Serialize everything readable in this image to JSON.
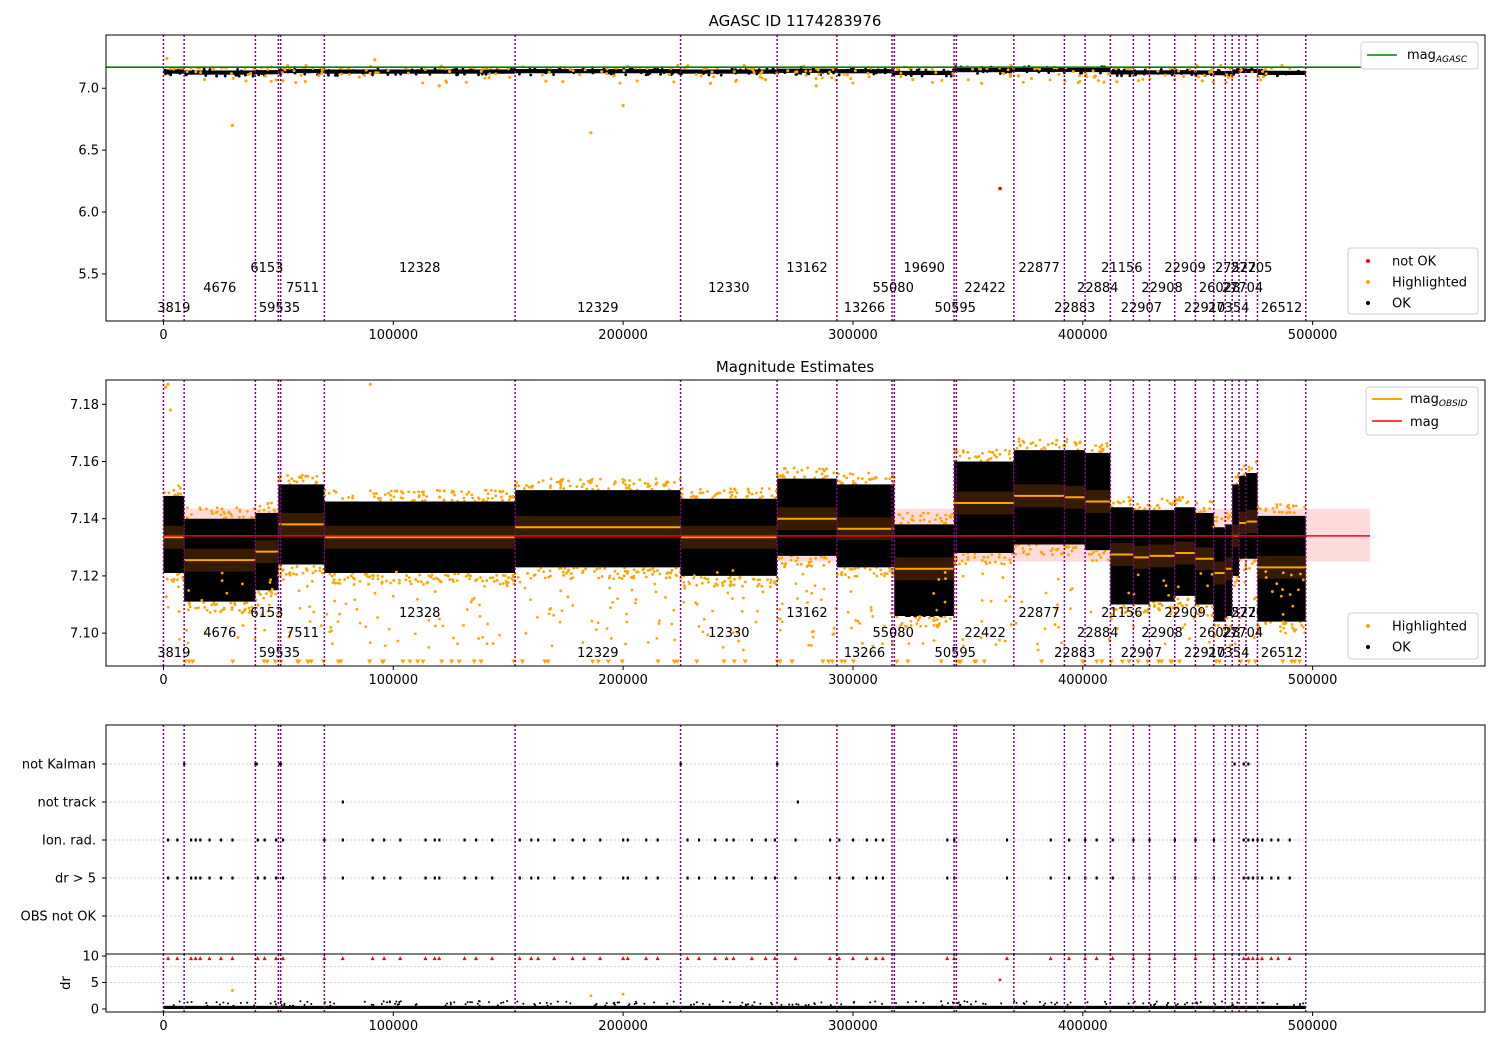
{
  "chart_data": [
    {
      "type": "scatter",
      "title": "AGASC ID 1174283976",
      "xlim": [
        -25000,
        575000
      ],
      "ylim": [
        5.12,
        7.43
      ],
      "xticks": [
        0,
        100000,
        200000,
        300000,
        400000,
        500000
      ],
      "xtick_labels": [
        "0",
        "100000",
        "200000",
        "300000",
        "400000",
        "500000"
      ],
      "yticks": [
        5.5,
        6.0,
        6.5,
        7.0
      ],
      "ytick_labels": [
        "5.5",
        "6.0",
        "6.5",
        "7.0"
      ],
      "reference_line": {
        "name": "mag$_{AGASC}$",
        "label_main": "mag",
        "label_sub": "AGASC",
        "y": 7.17,
        "color": "#008000"
      },
      "series": [
        {
          "name": "not OK",
          "color": "#ff0000",
          "points": [
            [
              364000,
              6.19
            ]
          ]
        },
        {
          "name": "Highlighted",
          "color": "#ffa500",
          "points": [
            [
              1500,
              7.24
            ],
            [
              30000,
              6.7
            ],
            [
              92000,
              7.23
            ],
            [
              52000,
              7.06
            ],
            [
              120000,
              7.02
            ],
            [
              186000,
              6.64
            ],
            [
              196000,
              7.1
            ],
            [
              200000,
              6.86
            ],
            [
              238000,
              7.04
            ],
            [
              262000,
              7.07
            ],
            [
              284000,
              7.02
            ],
            [
              326000,
              7.07
            ],
            [
              356000,
              7.04
            ],
            [
              372000,
              7.1
            ],
            [
              405000,
              7.09
            ],
            [
              440000,
              7.07
            ],
            [
              452000,
              7.06
            ]
          ]
        },
        {
          "name": "OK",
          "color": "#000000",
          "points": []
        }
      ],
      "legend_items": [
        "not OK",
        "Highlighted",
        "OK"
      ],
      "legend_ref": "top-right",
      "legend_points": "lower-right"
    },
    {
      "type": "scatter",
      "title": "Magnitude Estimates",
      "xlim": [
        -25000,
        575000
      ],
      "ylim": [
        7.0885,
        7.1885
      ],
      "xticks": [
        0,
        100000,
        200000,
        300000,
        400000,
        500000
      ],
      "xtick_labels": [
        "0",
        "100000",
        "200000",
        "300000",
        "400000",
        "500000"
      ],
      "yticks": [
        7.1,
        7.12,
        7.14,
        7.16,
        7.18
      ],
      "ytick_labels": [
        "7.10",
        "7.12",
        "7.14",
        "7.16",
        "7.18"
      ],
      "mag_line": {
        "name": "mag",
        "y": 7.134,
        "band": [
          7.125,
          7.1435
        ],
        "color": "#ff0000"
      },
      "obsid_series_name": "mag$_{OBSID}$",
      "obsid_label_main": "mag",
      "obsid_label_sub": "OBSID",
      "legend_items": [
        "Highlighted",
        "OK"
      ]
    },
    {
      "type": "scatter",
      "title": "",
      "xlim": [
        -25000,
        575000
      ],
      "flag_rows": [
        "not Kalman",
        "not track",
        "Ion. rad.",
        "dr > 5",
        "OBS not OK"
      ],
      "dr_yticks": [
        0,
        5,
        10
      ],
      "dr_ytick_labels": [
        "0",
        "5",
        "10"
      ],
      "dr_ylabel": "dr"
    }
  ],
  "observations": [
    {
      "obsid": "3819",
      "start": 0,
      "end": 9000,
      "mag": 7.1335,
      "y_lo": 7.121,
      "y_hi": 7.148
    },
    {
      "obsid": "4676",
      "start": 9000,
      "end": 40000,
      "mag": 7.1255,
      "y_lo": 7.111,
      "y_hi": 7.14
    },
    {
      "obsid": "6153",
      "start": 40000,
      "end": 50000,
      "mag": 7.1285,
      "y_lo": 7.115,
      "y_hi": 7.142
    },
    {
      "obsid": "59535",
      "start": 50000,
      "end": 51000,
      "mag": 7.138,
      "y_lo": 7.124,
      "y_hi": 7.152
    },
    {
      "obsid": "7511",
      "start": 51000,
      "end": 70000,
      "mag": 7.138,
      "y_lo": 7.124,
      "y_hi": 7.152
    },
    {
      "obsid": "12328",
      "start": 70000,
      "end": 153000,
      "mag": 7.1335,
      "y_lo": 7.121,
      "y_hi": 7.146
    },
    {
      "obsid": "12329",
      "start": 153000,
      "end": 225000,
      "mag": 7.137,
      "y_lo": 7.123,
      "y_hi": 7.15
    },
    {
      "obsid": "12330",
      "start": 225000,
      "end": 267000,
      "mag": 7.1335,
      "y_lo": 7.12,
      "y_hi": 7.147
    },
    {
      "obsid": "13162",
      "start": 267000,
      "end": 293000,
      "mag": 7.14,
      "y_lo": 7.127,
      "y_hi": 7.154
    },
    {
      "obsid": "13266",
      "start": 293000,
      "end": 317000,
      "mag": 7.1365,
      "y_lo": 7.123,
      "y_hi": 7.152
    },
    {
      "obsid": "55080",
      "start": 317000,
      "end": 318000,
      "mag": 7.1365,
      "y_lo": 7.123,
      "y_hi": 7.152
    },
    {
      "obsid": "19690",
      "start": 318000,
      "end": 344000,
      "mag": 7.1225,
      "y_lo": 7.106,
      "y_hi": 7.138
    },
    {
      "obsid": "50595",
      "start": 344000,
      "end": 345000,
      "mag": 7.1455,
      "y_lo": 7.128,
      "y_hi": 7.16
    },
    {
      "obsid": "22422",
      "start": 345000,
      "end": 370000,
      "mag": 7.1455,
      "y_lo": 7.128,
      "y_hi": 7.16
    },
    {
      "obsid": "22877",
      "start": 370000,
      "end": 392000,
      "mag": 7.148,
      "y_lo": 7.131,
      "y_hi": 7.164
    },
    {
      "obsid": "22883",
      "start": 392000,
      "end": 401000,
      "mag": 7.1475,
      "y_lo": 7.131,
      "y_hi": 7.164
    },
    {
      "obsid": "22884",
      "start": 401000,
      "end": 412000,
      "mag": 7.146,
      "y_lo": 7.129,
      "y_hi": 7.163
    },
    {
      "obsid": "21156",
      "start": 412000,
      "end": 422000,
      "mag": 7.1275,
      "y_lo": 7.11,
      "y_hi": 7.144
    },
    {
      "obsid": "22907",
      "start": 422000,
      "end": 429000,
      "mag": 7.1265,
      "y_lo": 7.11,
      "y_hi": 7.143
    },
    {
      "obsid": "22908",
      "start": 429000,
      "end": 440000,
      "mag": 7.127,
      "y_lo": 7.111,
      "y_hi": 7.143
    },
    {
      "obsid": "22909",
      "start": 440000,
      "end": 449000,
      "mag": 7.128,
      "y_lo": 7.113,
      "y_hi": 7.144
    },
    {
      "obsid": "22910",
      "start": 449000,
      "end": 457000,
      "mag": 7.126,
      "y_lo": 7.11,
      "y_hi": 7.142
    },
    {
      "obsid": "26028",
      "start": 457000,
      "end": 462000,
      "mag": 7.121,
      "y_lo": 7.104,
      "y_hi": 7.137
    },
    {
      "obsid": "27354",
      "start": 462000,
      "end": 465000,
      "mag": 7.1225,
      "y_lo": 7.106,
      "y_hi": 7.138
    },
    {
      "obsid": "27522",
      "start": 465000,
      "end": 468000,
      "mag": 7.134,
      "y_lo": 7.12,
      "y_hi": 7.152
    },
    {
      "obsid": "27704",
      "start": 468000,
      "end": 471000,
      "mag": 7.1385,
      "y_lo": 7.126,
      "y_hi": 7.155
    },
    {
      "obsid": "27705",
      "start": 471000,
      "end": 476000,
      "mag": 7.139,
      "y_lo": 7.126,
      "y_hi": 7.156
    },
    {
      "obsid": "26512",
      "start": 476000,
      "end": 497000,
      "mag": 7.123,
      "y_lo": 7.104,
      "y_hi": 7.141
    }
  ],
  "obs_boundaries": [
    0,
    9000,
    40000,
    50000,
    51000,
    70000,
    153000,
    225000,
    267000,
    293000,
    317000,
    318000,
    344000,
    345000,
    370000,
    392000,
    401000,
    412000,
    422000,
    429000,
    440000,
    449000,
    457000,
    462000,
    465000,
    468000,
    471000,
    476000,
    497000
  ],
  "obs_label_rows": [
    {
      "obsid": "3819",
      "x": 4500,
      "row": 0
    },
    {
      "obsid": "4676",
      "x": 24500,
      "row": 1
    },
    {
      "obsid": "6153",
      "x": 45000,
      "row": 2
    },
    {
      "obsid": "59535",
      "x": 50500,
      "row": 0
    },
    {
      "obsid": "7511",
      "x": 60500,
      "row": 1
    },
    {
      "obsid": "12328",
      "x": 111500,
      "row": 2
    },
    {
      "obsid": "12329",
      "x": 189000,
      "row": 0
    },
    {
      "obsid": "12330",
      "x": 246000,
      "row": 1
    },
    {
      "obsid": "13162",
      "x": 280000,
      "row": 2
    },
    {
      "obsid": "13266",
      "x": 305000,
      "row": 0
    },
    {
      "obsid": "55080",
      "x": 317500,
      "row": 1
    },
    {
      "obsid": "19690",
      "x": 331000,
      "row": 2
    },
    {
      "obsid": "50595",
      "x": 344500,
      "row": 0
    },
    {
      "obsid": "22422",
      "x": 357500,
      "row": 1
    },
    {
      "obsid": "22877",
      "x": 381000,
      "row": 2
    },
    {
      "obsid": "22883",
      "x": 396500,
      "row": 0
    },
    {
      "obsid": "22884",
      "x": 406500,
      "row": 1
    },
    {
      "obsid": "21156",
      "x": 417000,
      "row": 2
    },
    {
      "obsid": "22907",
      "x": 425500,
      "row": 0
    },
    {
      "obsid": "22908",
      "x": 434500,
      "row": 1
    },
    {
      "obsid": "22909",
      "x": 444500,
      "row": 2
    },
    {
      "obsid": "22910",
      "x": 453000,
      "row": 0
    },
    {
      "obsid": "26028",
      "x": 459500,
      "row": 1
    },
    {
      "obsid": "27354",
      "x": 463500,
      "row": 0
    },
    {
      "obsid": "27522",
      "x": 466500,
      "row": 2
    },
    {
      "obsid": "27704",
      "x": 469500,
      "row": 1
    },
    {
      "obsid": "27705",
      "x": 473500,
      "row": 2
    },
    {
      "obsid": "26512",
      "x": 486500,
      "row": 0
    }
  ],
  "flag_events": {
    "not Kalman": [
      9000,
      40000,
      40500,
      50500,
      51000,
      225000,
      267000,
      466000,
      470000,
      472000
    ],
    "not track": [
      78000,
      276000
    ],
    "Ion. rad.": [
      2000,
      6000,
      12000,
      14000,
      16000,
      20000,
      25000,
      30000,
      41000,
      44000,
      49000,
      52000,
      70000,
      78000,
      91000,
      96000,
      103000,
      114000,
      118000,
      120000,
      131000,
      136000,
      143000,
      155000,
      160000,
      163000,
      170000,
      178000,
      183000,
      190000,
      200000,
      202000,
      210000,
      215000,
      228000,
      233000,
      240000,
      245000,
      248000,
      256000,
      262000,
      266000,
      275000,
      290000,
      294000,
      300000,
      306000,
      310000,
      313000,
      341000,
      344000,
      367000,
      386000,
      394000,
      401000,
      406000,
      413000,
      422000,
      429000,
      440000,
      449000,
      457000,
      470000,
      472000,
      474000,
      476000,
      478000,
      482000,
      485000,
      490000
    ],
    "dr > 5": [
      2000,
      6000,
      12000,
      14000,
      16000,
      20000,
      25000,
      30000,
      41000,
      44000,
      49000,
      52000,
      70000,
      78000,
      91000,
      96000,
      103000,
      114000,
      118000,
      120000,
      131000,
      136000,
      143000,
      155000,
      160000,
      163000,
      170000,
      178000,
      183000,
      190000,
      200000,
      202000,
      210000,
      215000,
      228000,
      233000,
      240000,
      245000,
      248000,
      256000,
      262000,
      266000,
      275000,
      290000,
      294000,
      300000,
      306000,
      310000,
      313000,
      341000,
      344000,
      367000,
      386000,
      394000,
      401000,
      406000,
      413000,
      422000,
      429000,
      440000,
      449000,
      457000,
      470000,
      472000,
      474000,
      476000,
      478000,
      482000,
      485000,
      490000
    ],
    "OBS not OK": []
  },
  "dr_outliers": [
    [
      30000,
      3.5
    ],
    [
      364000,
      5.5
    ],
    [
      200000,
      2.8
    ],
    [
      186000,
      2.5
    ]
  ],
  "colors": {
    "ok": "#000000",
    "highlighted": "#ffa500",
    "not_ok": "#ff0000",
    "agasc_line": "#008000",
    "mag_line": "#ff0000",
    "mag_band": "#ffcccc",
    "obsid_line": "#ffa500",
    "boundary": "#800080"
  }
}
